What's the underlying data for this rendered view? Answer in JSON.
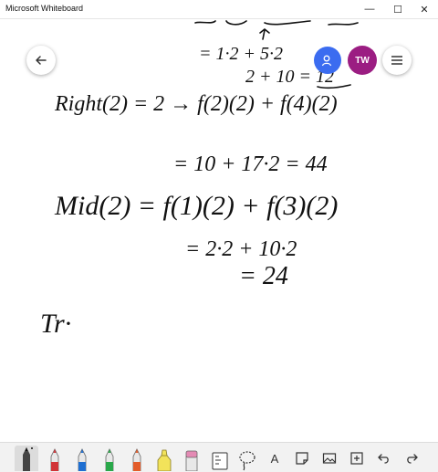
{
  "window": {
    "title": "Microsoft Whiteboard",
    "minimize": "—",
    "maximize": "☐",
    "close": "✕"
  },
  "header": {
    "avatar_initials": "TW",
    "share_color": "#3b6cf0",
    "avatar_color": "#9b1d82"
  },
  "ink": {
    "line1": "= 1·2 + 5·2",
    "line2": "2 + 10 = 12",
    "line3": "Right(2) = 2 → f(2)(2) + f(4)(2)",
    "line4": "= 10 + 17·2 = 44",
    "line5": "Mid(2) = f(1)(2) + f(3)(2)",
    "line6": "= 2·2 + 10·2",
    "line7": "= 24",
    "line8": "Tr·"
  },
  "toolbar": {
    "tools": [
      {
        "name": "pen-black",
        "color": "#111111",
        "active": true
      },
      {
        "name": "pen-red",
        "color": "#d13438"
      },
      {
        "name": "pen-blue",
        "color": "#1f6fd1"
      },
      {
        "name": "pen-green",
        "color": "#2aa84a"
      },
      {
        "name": "pen-orange",
        "color": "#e35c2a"
      },
      {
        "name": "highlighter-yellow",
        "color": "#f2e35a"
      },
      {
        "name": "eraser",
        "color": "#e48ab4"
      }
    ],
    "text_tool_glyph": "A"
  }
}
